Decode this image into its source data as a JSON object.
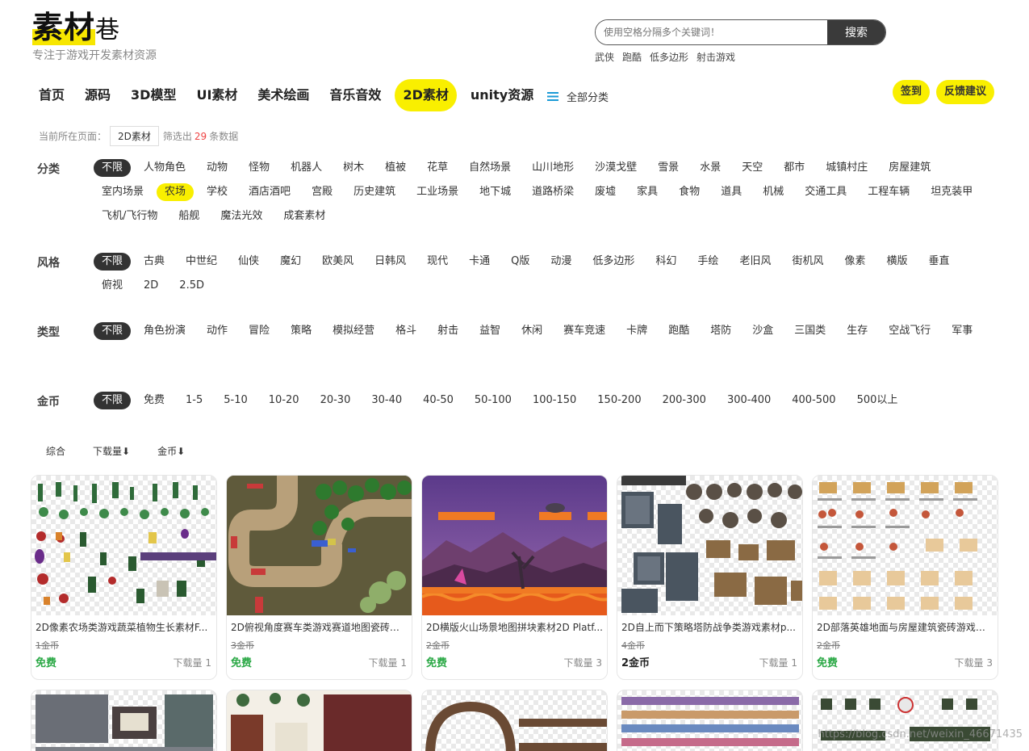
{
  "logo": {
    "part1": "素材",
    "part2": "巷",
    "tagline": "专注于游戏开发素材资源"
  },
  "search": {
    "placeholder": "使用空格分隔多个关键词！",
    "button": "搜索",
    "hot": [
      "武侠",
      "跑酷",
      "低多边形",
      "射击游戏"
    ]
  },
  "nav": {
    "items": [
      "首页",
      "源码",
      "3D模型",
      "UI素材",
      "美术绘画",
      "音乐音效",
      "2D素材",
      "unity资源"
    ],
    "active_index": 6,
    "all_categories": "全部分类",
    "checkin": "签到",
    "feedback": "反馈建议"
  },
  "crumb": {
    "prefix": "当前所在页面：",
    "current": "2D素材",
    "filtered": "筛选出",
    "count": "29",
    "suffix": "条数据"
  },
  "filters": {
    "category": {
      "label": "分类",
      "items": [
        "不限",
        "人物角色",
        "动物",
        "怪物",
        "机器人",
        "树木",
        "植被",
        "花草",
        "自然场景",
        "山川地形",
        "沙漠戈壁",
        "雪景",
        "水景",
        "天空",
        "都市",
        "城镇村庄",
        "房屋建筑",
        "室内场景",
        "农场",
        "学校",
        "酒店酒吧",
        "宫殿",
        "历史建筑",
        "工业场景",
        "地下城",
        "道路桥梁",
        "废墟",
        "家具",
        "食物",
        "道具",
        "机械",
        "交通工具",
        "工程车辆",
        "坦克装甲",
        "飞机/飞行物",
        "船舰",
        "魔法光效",
        "成套素材"
      ]
    },
    "style": {
      "label": "风格",
      "items": [
        "不限",
        "古典",
        "中世纪",
        "仙侠",
        "魔幻",
        "欧美风",
        "日韩风",
        "现代",
        "卡通",
        "Q版",
        "动漫",
        "低多边形",
        "科幻",
        "手绘",
        "老旧风",
        "街机风",
        "像素",
        "横版",
        "垂直",
        "俯视",
        "2D",
        "2.5D"
      ]
    },
    "type": {
      "label": "类型",
      "items": [
        "不限",
        "角色扮演",
        "动作",
        "冒险",
        "策略",
        "模拟经营",
        "格斗",
        "射击",
        "益智",
        "休闲",
        "赛车竞速",
        "卡牌",
        "跑酷",
        "塔防",
        "沙盒",
        "三国类",
        "生存",
        "空战飞行",
        "军事"
      ]
    },
    "coin": {
      "label": "金币",
      "items": [
        "不限",
        "免费",
        "1-5",
        "5-10",
        "10-20",
        "20-30",
        "30-40",
        "40-50",
        "50-100",
        "100-150",
        "150-200",
        "200-300",
        "300-400",
        "400-500",
        "500以上"
      ]
    }
  },
  "sort": [
    "综合",
    "下载量⬇",
    "金币⬇"
  ],
  "cards": [
    {
      "title": "2D像素农场类游戏蔬菜植物生长素材F...",
      "old_price": "1金币",
      "price": "免费",
      "downloads": "下载量 1",
      "free": true
    },
    {
      "title": "2D俯视角度赛车类游戏赛道地图瓷砖拼...",
      "old_price": "3金币",
      "price": "免费",
      "downloads": "下载量 1",
      "free": true
    },
    {
      "title": "2D横版火山场景地图拼块素材2D Platf...",
      "old_price": "2金币",
      "price": "免费",
      "downloads": "下载量 3",
      "free": true
    },
    {
      "title": "2D自上而下策略塔防战争类游戏素材p...",
      "old_price": "4金币",
      "price": "2金币",
      "downloads": "下载量 1",
      "free": false
    },
    {
      "title": "2D部落英雄地面与房屋建筑瓷砖游戏素...",
      "old_price": "2金币",
      "price": "免费",
      "downloads": "下载量 3",
      "free": true
    }
  ],
  "watermark": "https://blog.csdn.net/weixin_46671435",
  "colors": {
    "accent_yellow": "#f9ef00",
    "selected_dark": "#333333",
    "free_green": "#2aa845"
  }
}
